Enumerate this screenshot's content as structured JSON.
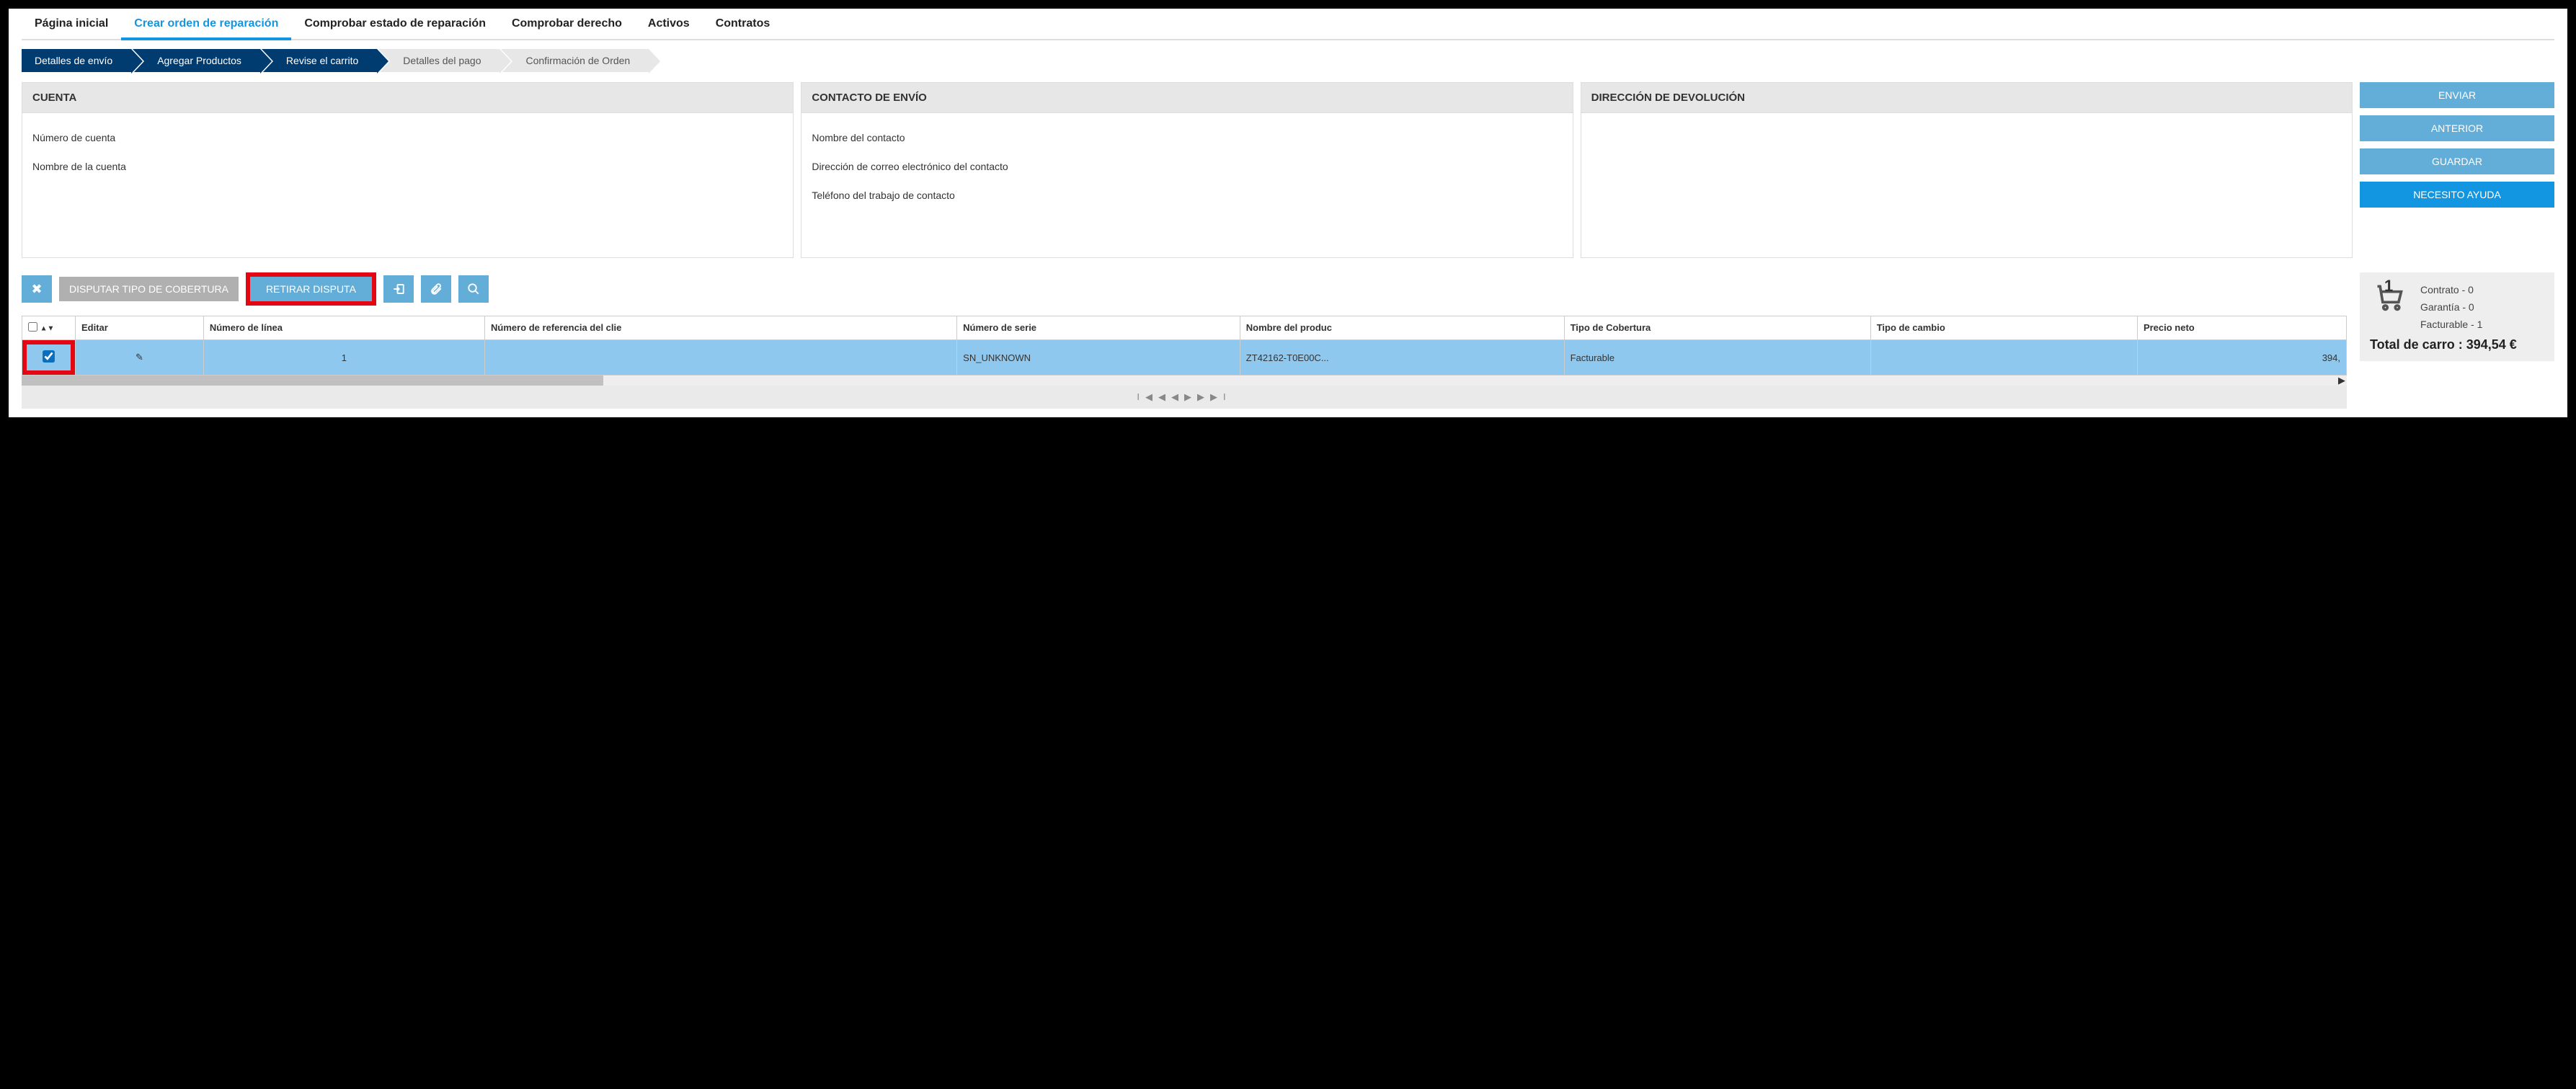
{
  "nav": {
    "items": [
      {
        "label": "Página inicial",
        "active": false
      },
      {
        "label": "Crear orden de reparación",
        "active": true
      },
      {
        "label": "Comprobar estado de reparación",
        "active": false
      },
      {
        "label": "Comprobar derecho",
        "active": false
      },
      {
        "label": "Activos",
        "active": false
      },
      {
        "label": "Contratos",
        "active": false
      }
    ]
  },
  "wizard": {
    "steps": [
      {
        "label": "Detalles de envío",
        "active": true
      },
      {
        "label": "Agregar Productos",
        "active": true
      },
      {
        "label": "Revise el carrito",
        "active": true
      },
      {
        "label": "Detalles del pago",
        "active": false
      },
      {
        "label": "Confirmación de Orden",
        "active": false
      }
    ]
  },
  "cards": {
    "account": {
      "title": "CUENTA",
      "fields": [
        "Número de cuenta",
        "Nombre de la cuenta"
      ]
    },
    "contact": {
      "title": "CONTACTO DE ENVÍO",
      "fields": [
        "Nombre del contacto",
        "Dirección de correo electrónico del contacto",
        "Teléfono del trabajo de contacto"
      ]
    },
    "return": {
      "title": "DIRECCIÓN DE DEVOLUCIÓN",
      "fields": []
    }
  },
  "sidebar": {
    "buttons": {
      "send": "ENVIAR",
      "previous": "ANTERIOR",
      "save": "GUARDAR",
      "help": "NECESITO AYUDA"
    }
  },
  "toolbar": {
    "close_icon": "✖",
    "dispute": "DISPUTAR TIPO DE COBERTURA",
    "withdraw": "RETIRAR DISPUTA",
    "import_icon": "↪",
    "attach_icon": "📎",
    "search_icon": "🔍"
  },
  "table": {
    "headers": [
      "",
      "Editar",
      "Número de línea",
      "Número de referencia del clie",
      "Número de serie",
      "Nombre del produc",
      "Tipo de Cobertura",
      "Tipo de cambio",
      "Precio neto"
    ],
    "rows": [
      {
        "checked": true,
        "edit": "✎",
        "line": "1",
        "ref": "",
        "serial": "SN_UNKNOWN",
        "product": "ZT42162-T0E00C...",
        "coverage": "Facturable",
        "exchange": "",
        "price": "394,"
      }
    ]
  },
  "cart": {
    "badge": "1",
    "lines": {
      "contract": "Contrato - 0",
      "warranty": "Garantía - 0",
      "billable": "Facturable - 1"
    },
    "total": "Total de carro : 394,54 €"
  },
  "pager": {
    "first": "⏮",
    "prev": "◀◀",
    "next": "▶▶",
    "last": "⏭"
  }
}
